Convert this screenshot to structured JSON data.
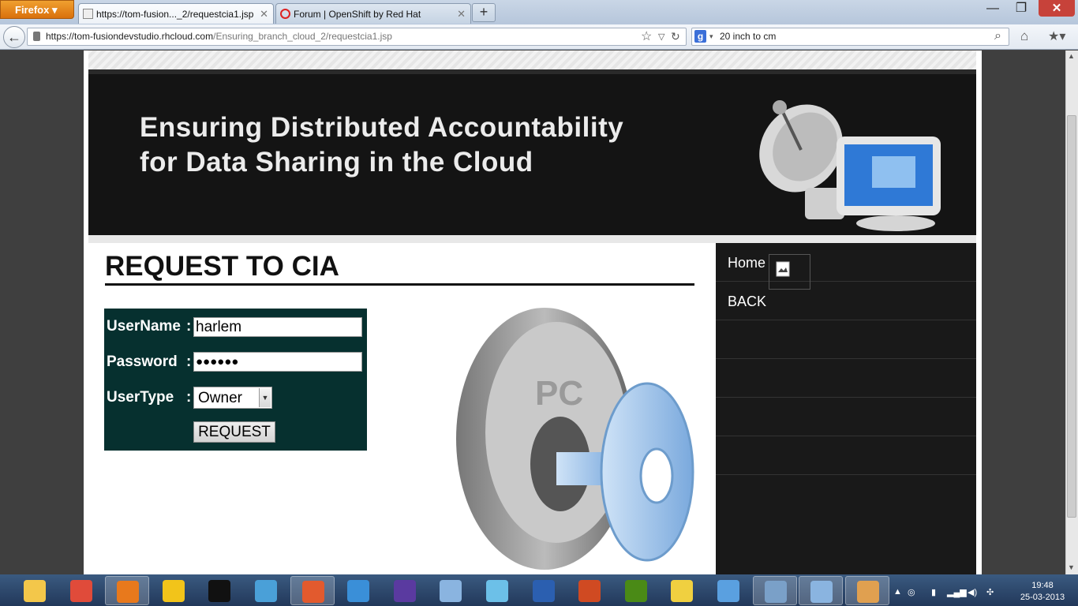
{
  "browser": {
    "firefox_button": "Firefox",
    "tabs": [
      {
        "title": "https://tom-fusion..._2/requestcia1.jsp",
        "active": true
      },
      {
        "title": "Forum | OpenShift by Red Hat",
        "active": false
      }
    ],
    "url_host": "https://tom-fusiondevstudio.rhcloud.com",
    "url_path": "/Ensuring_branch_cloud_2/requestcia1.jsp",
    "search_value": "20 inch to cm"
  },
  "banner": {
    "line1": "Ensuring Distributed Accountability",
    "line2": "for Data Sharing in the Cloud"
  },
  "main": {
    "title": "REQUEST TO CIA",
    "form": {
      "username_label": "UserName",
      "username_value": "harlem",
      "password_label": "Password",
      "password_value": "●●●●●●",
      "usertype_label": "UserType",
      "usertype_value": "Owner",
      "colon": ":",
      "submit_label": "REQUEST"
    },
    "key_graphic_text": "PC"
  },
  "sidebar": {
    "items": [
      {
        "label": "Home"
      },
      {
        "label": "BACK"
      },
      {
        "label": ""
      },
      {
        "label": ""
      },
      {
        "label": ""
      },
      {
        "label": ""
      }
    ]
  },
  "taskbar": {
    "time": "19:48",
    "date": "25-03-2013",
    "apps": [
      "explorer-icon",
      "chrome-icon",
      "firefox-icon",
      "vmware-icon",
      "cmd-icon",
      "app-icon",
      "git-icon",
      "itunes-icon",
      "eclipse-icon",
      "virtualbox-icon",
      "notepad-icon",
      "word-icon",
      "powerpoint-icon",
      "dreamweaver-icon",
      "sticky-notes-icon",
      "remote-icon",
      "monitor-icon",
      "virtualbox-icon-2",
      "paint-icon"
    ]
  },
  "colors": {
    "form_bg": "#06302f",
    "banner_bg": "#141414",
    "sidebar_bg": "#191919",
    "firefox_orange": "#e07b14"
  }
}
